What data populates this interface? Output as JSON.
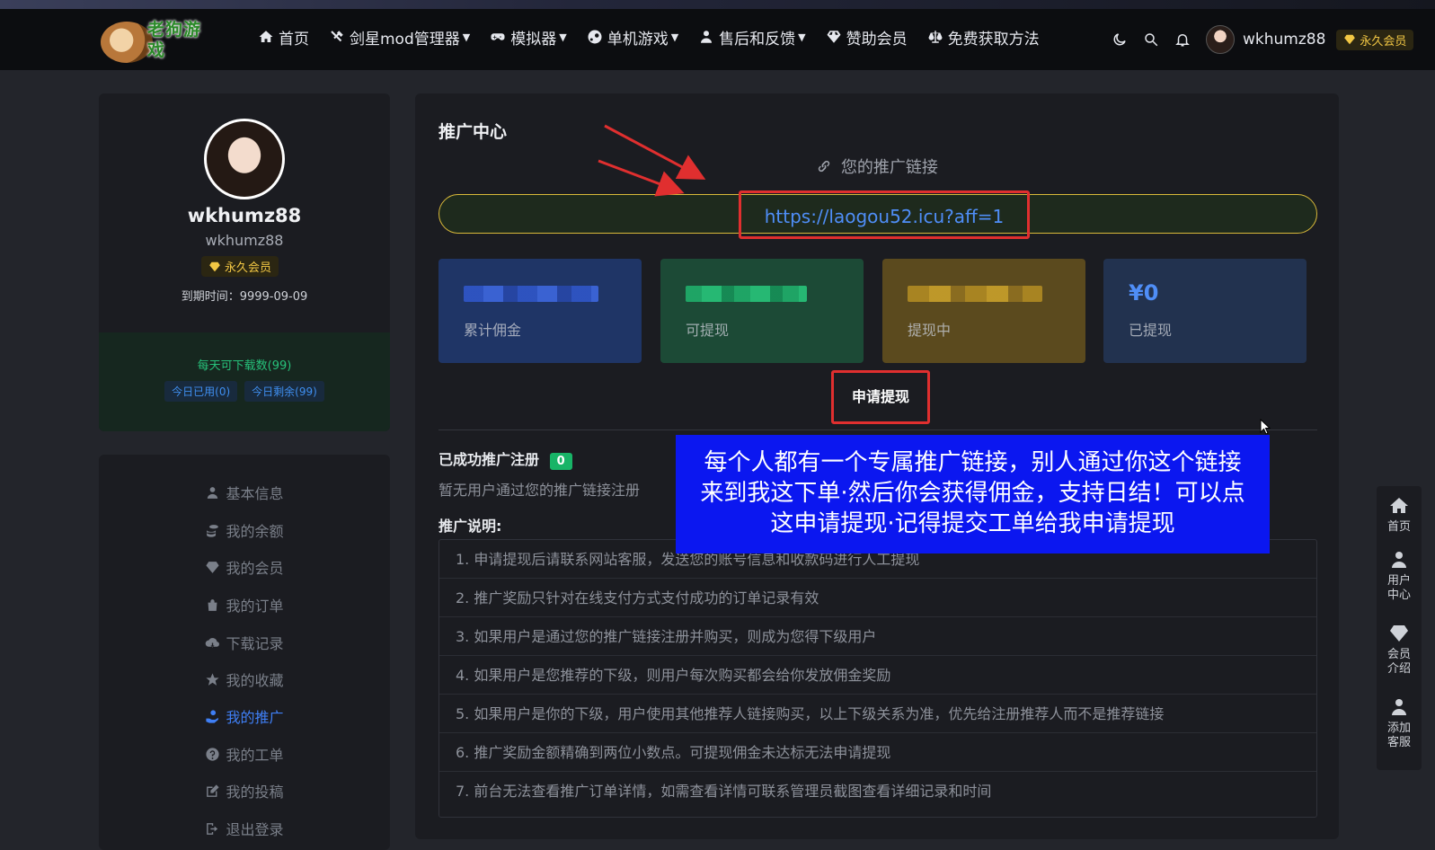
{
  "nav": {
    "logo_text": "老狗游戏",
    "items": [
      {
        "label": "首页",
        "icon": "home-icon",
        "dropdown": false
      },
      {
        "label": "剑星mod管理器",
        "icon": "tools-icon",
        "dropdown": true
      },
      {
        "label": "模拟器",
        "icon": "gamepad-icon",
        "dropdown": true
      },
      {
        "label": "单机游戏",
        "icon": "steam-icon",
        "dropdown": true
      },
      {
        "label": "售后和反馈",
        "icon": "user-tie-icon",
        "dropdown": true
      },
      {
        "label": "赞助会员",
        "icon": "diamond-icon",
        "dropdown": false
      },
      {
        "label": "免费获取方法",
        "icon": "scale-icon",
        "dropdown": false
      }
    ],
    "username": "wkhumz88",
    "vip_label": "永久会员"
  },
  "profile": {
    "name": "wkhumz88",
    "subname": "wkhumz88",
    "vip_label": "永久会员",
    "expire": "到期时间：9999-09-09",
    "downloads_title": "每天可下载数(99)",
    "used_today": "今日已用(0)",
    "remaining_today": "今日剩余(99)"
  },
  "menu": [
    {
      "label": "基本信息",
      "icon": "user-icon",
      "active": false
    },
    {
      "label": "我的余额",
      "icon": "coins-icon",
      "active": false
    },
    {
      "label": "我的会员",
      "icon": "diamond-icon",
      "active": false
    },
    {
      "label": "我的订单",
      "icon": "bag-icon",
      "active": false
    },
    {
      "label": "下载记录",
      "icon": "cloud-download-icon",
      "active": false
    },
    {
      "label": "我的收藏",
      "icon": "star-icon",
      "active": false
    },
    {
      "label": "我的推广",
      "icon": "hand-coin-icon",
      "active": true
    },
    {
      "label": "我的工单",
      "icon": "question-icon",
      "active": false
    },
    {
      "label": "我的投稿",
      "icon": "edit-icon",
      "active": false
    },
    {
      "label": "退出登录",
      "icon": "logout-icon",
      "active": false
    }
  ],
  "promo": {
    "title": "推广中心",
    "link_caption": "您的推广链接",
    "link": "https://laogou52.icu?aff=1",
    "stats": [
      {
        "label": "累计佣金",
        "value": "",
        "color": "#1f3566"
      },
      {
        "label": "可提现",
        "value": "",
        "color": "#1c4a36"
      },
      {
        "label": "提现中",
        "value": "",
        "color": "#5b4a1e"
      },
      {
        "label": "已提现",
        "value": "¥0",
        "color": "#22324f"
      }
    ],
    "withdraw_button": "申请提现",
    "registered_label": "已成功推广注册",
    "registered_count": "0",
    "registered_empty": "暂无用户通过您的推广链接注册",
    "rules_title": "推广说明:",
    "rules": [
      "1. 申请提现后请联系网站客服，发送您的账号信息和收款码进行人工提现",
      "2. 推广奖励只针对在线支付方式支付成功的订单记录有效",
      "3. 如果用户是通过您的推广链接注册并购买，则成为您得下级用户",
      "4. 如果用户是您推荐的下级，则用户每次购买都会给你发放佣金奖励",
      "5. 如果用户是你的下级，用户使用其他推荐人链接购买，以上下级关系为准，优先给注册推荐人而不是推荐链接",
      "6. 推广奖励金额精确到两位小数点。可提现佣金未达标无法申请提现",
      "7. 前台无法查看推广订单详情，如需查看详情可联系管理员截图查看详细记录和时间"
    ]
  },
  "annotation": {
    "line1": "每个人都有一个专属推广链接，别人通过你这个链接",
    "line2": "来到我这下单·然后你会获得佣金，支持日结！可以点",
    "line3": "这申请提现·记得提交工单给我申请提现"
  },
  "float_bar": [
    {
      "label": "首页",
      "icon": "home-icon"
    },
    {
      "label": "用户中心",
      "icon": "user-icon"
    },
    {
      "label": "会员介绍",
      "icon": "diamond-icon"
    },
    {
      "label": "添加客服",
      "icon": "user-tie-icon"
    }
  ]
}
